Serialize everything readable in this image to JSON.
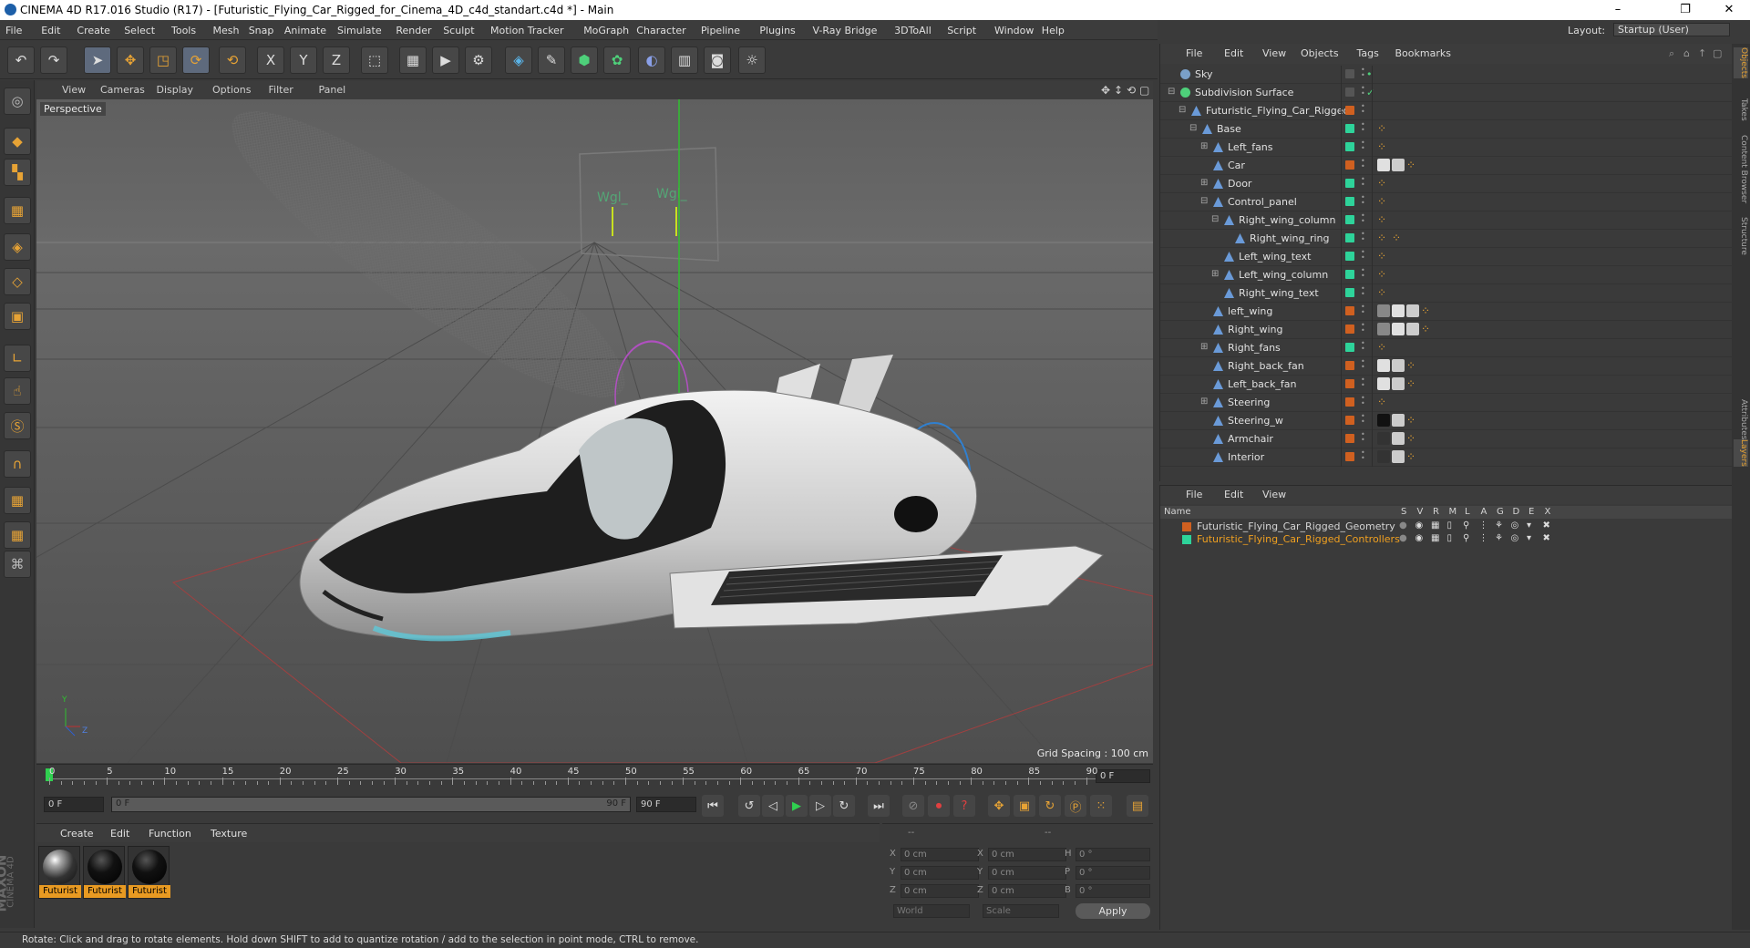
{
  "window": {
    "title": "CINEMA 4D R17.016 Studio (R17) - [Futuristic_Flying_Car_Rigged_for_Cinema_4D_c4d_standart.c4d *] - Main",
    "minimize": "–",
    "maximize": "❐",
    "close": "✕"
  },
  "menubar": [
    "File",
    "Edit",
    "Create",
    "Select",
    "Tools",
    "Mesh",
    "Snap",
    "Animate",
    "Simulate",
    "Render",
    "Sculpt",
    "Motion Tracker",
    "MoGraph",
    "Character",
    "Pipeline",
    "Plugins",
    "V-Ray Bridge",
    "3DToAll",
    "Script",
    "Window",
    "Help"
  ],
  "layout": {
    "label": "Layout:",
    "value": "Startup (User)"
  },
  "toolbar": {
    "icons": [
      "undo-icon",
      "redo-icon",
      "select-icon",
      "move-icon",
      "scale-icon",
      "rotate-icon",
      "recent-icon",
      "x-axis-icon",
      "y-axis-icon",
      "z-axis-icon",
      "coord-icon",
      "render-view-icon",
      "render-icon",
      "render-settings-icon",
      "cube-icon",
      "spline-pen-icon",
      "nurbs-icon",
      "array-icon",
      "deformer-icon",
      "floor-icon",
      "camera-icon",
      "light-icon"
    ],
    "xyz": [
      "X",
      "Y",
      "Z"
    ]
  },
  "viewport": {
    "menu": [
      "View",
      "Cameras",
      "Display",
      "Options",
      "Filter",
      "Panel"
    ],
    "label": "Perspective",
    "grid_spacing": "Grid Spacing : 100 cm",
    "axis_y": "Y",
    "axis_z": "Z"
  },
  "timeline": {
    "ticks": [
      "0",
      "5",
      "10",
      "15",
      "20",
      "25",
      "30",
      "35",
      "40",
      "45",
      "50",
      "55",
      "60",
      "65",
      "70",
      "75",
      "80",
      "85",
      "90"
    ],
    "frame_field": "0 F"
  },
  "transport": {
    "start": "0 F",
    "min": "0 F",
    "max": "90 F",
    "end": "90 F"
  },
  "materials": {
    "menu": [
      "Create",
      "Edit",
      "Function",
      "Texture"
    ],
    "items": [
      "Futurist",
      "Futurist",
      "Futurist"
    ]
  },
  "coords": {
    "headers": [
      "--",
      "--",
      "--"
    ],
    "rows": [
      {
        "a": "X",
        "av": "0 cm",
        "b": "X",
        "bv": "0 cm",
        "c": "H",
        "cv": "0 °"
      },
      {
        "a": "Y",
        "av": "0 cm",
        "b": "Y",
        "bv": "0 cm",
        "c": "P",
        "cv": "0 °"
      },
      {
        "a": "Z",
        "av": "0 cm",
        "b": "Z",
        "bv": "0 cm",
        "c": "B",
        "cv": "0 °"
      }
    ],
    "world": "World",
    "scale": "Scale",
    "apply": "Apply"
  },
  "objects": {
    "menu": [
      "File",
      "Edit",
      "View",
      "Objects",
      "Tags",
      "Bookmarks"
    ],
    "rows": [
      {
        "name": "Sky",
        "indent": 0,
        "layer": "#555555",
        "expand": ""
      },
      {
        "name": "Subdivision Surface",
        "indent": 0,
        "layer": "#555555",
        "expand": "⊟"
      },
      {
        "name": "Futuristic_Flying_Car_Rigged",
        "indent": 1,
        "layer": "#d06020",
        "expand": "⊟"
      },
      {
        "name": "Base",
        "indent": 2,
        "layer": "#2ed39a",
        "expand": "⊟"
      },
      {
        "name": "Left_fans",
        "indent": 3,
        "layer": "#2ed39a",
        "expand": "⊞"
      },
      {
        "name": "Car",
        "indent": 3,
        "layer": "#d06020",
        "expand": ""
      },
      {
        "name": "Door",
        "indent": 3,
        "layer": "#2ed39a",
        "expand": "⊞"
      },
      {
        "name": "Control_panel",
        "indent": 3,
        "layer": "#2ed39a",
        "expand": "⊟"
      },
      {
        "name": "Right_wing_column",
        "indent": 4,
        "layer": "#2ed39a",
        "expand": "⊟"
      },
      {
        "name": "Right_wing_ring",
        "indent": 5,
        "layer": "#2ed39a",
        "expand": ""
      },
      {
        "name": "Left_wing_text",
        "indent": 4,
        "layer": "#2ed39a",
        "expand": ""
      },
      {
        "name": "Left_wing_column",
        "indent": 4,
        "layer": "#2ed39a",
        "expand": "⊞"
      },
      {
        "name": "Right_wing_text",
        "indent": 4,
        "layer": "#2ed39a",
        "expand": ""
      },
      {
        "name": "left_wing",
        "indent": 3,
        "layer": "#d06020",
        "expand": ""
      },
      {
        "name": "Right_wing",
        "indent": 3,
        "layer": "#d06020",
        "expand": ""
      },
      {
        "name": "Right_fans",
        "indent": 3,
        "layer": "#2ed39a",
        "expand": "⊞"
      },
      {
        "name": "Right_back_fan",
        "indent": 3,
        "layer": "#d06020",
        "expand": ""
      },
      {
        "name": "Left_back_fan",
        "indent": 3,
        "layer": "#d06020",
        "expand": ""
      },
      {
        "name": "Steering",
        "indent": 3,
        "layer": "#d06020",
        "expand": "⊞"
      },
      {
        "name": "Steering_w",
        "indent": 3,
        "layer": "#d06020",
        "expand": ""
      },
      {
        "name": "Armchair",
        "indent": 3,
        "layer": "#d06020",
        "expand": ""
      },
      {
        "name": "Interior",
        "indent": 3,
        "layer": "#d06020",
        "expand": ""
      }
    ]
  },
  "layers": {
    "menu": [
      "File",
      "Edit",
      "View"
    ],
    "name_header": "Name",
    "cols": [
      "S",
      "V",
      "R",
      "M",
      "L",
      "A",
      "G",
      "D",
      "E",
      "X"
    ],
    "rows": [
      {
        "name": "Futuristic_Flying_Car_Rigged_Geometry",
        "color": "#d06020",
        "text": "#d4d4d4"
      },
      {
        "name": "Futuristic_Flying_Car_Rigged_Controllers",
        "color": "#2ed39a",
        "text": "#f0a020"
      }
    ]
  },
  "right_tabs": [
    "Objects",
    "Takes",
    "Content Browser",
    "Structure",
    "Attributes",
    "Layers"
  ],
  "status": "Rotate: Click and drag to rotate elements. Hold down SHIFT to add to quantize rotation / add to the selection in point mode, CTRL to remove.",
  "brand": {
    "maxon": "MAXON",
    "c4d": "CINEMA 4D"
  }
}
